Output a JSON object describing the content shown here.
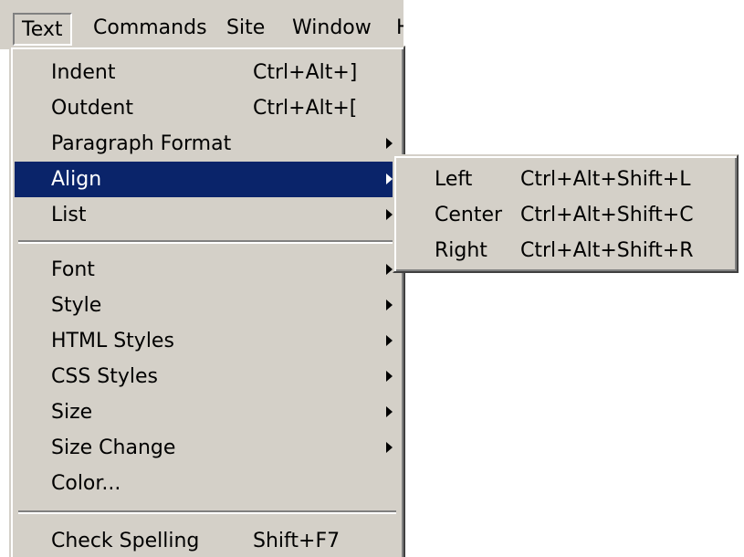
{
  "menubar": {
    "items": [
      {
        "label": "Text"
      },
      {
        "label": "Commands"
      },
      {
        "label": "Site"
      },
      {
        "label": "Window"
      },
      {
        "label": "H"
      }
    ]
  },
  "text_menu": {
    "items": [
      {
        "label": "Indent",
        "shortcut": "Ctrl+Alt+]"
      },
      {
        "label": "Outdent",
        "shortcut": "Ctrl+Alt+["
      },
      {
        "label": "Paragraph Format",
        "submenu": true
      },
      {
        "label": "Align",
        "submenu": true,
        "selected": true
      },
      {
        "label": "List",
        "submenu": true
      },
      {
        "label": "Font",
        "submenu": true
      },
      {
        "label": "Style",
        "submenu": true
      },
      {
        "label": "HTML Styles",
        "submenu": true
      },
      {
        "label": "CSS Styles",
        "submenu": true
      },
      {
        "label": "Size",
        "submenu": true
      },
      {
        "label": "Size Change",
        "submenu": true
      },
      {
        "label": "Color..."
      },
      {
        "label": "Check Spelling",
        "shortcut": "Shift+F7"
      }
    ]
  },
  "align_submenu": {
    "items": [
      {
        "label": "Left",
        "shortcut": "Ctrl+Alt+Shift+L"
      },
      {
        "label": "Center",
        "shortcut": "Ctrl+Alt+Shift+C"
      },
      {
        "label": "Right",
        "shortcut": "Ctrl+Alt+Shift+R"
      }
    ]
  },
  "colors": {
    "menu_face": "#d4d0c8",
    "highlight": "#0a246a",
    "highlight_text": "#ffffff"
  }
}
